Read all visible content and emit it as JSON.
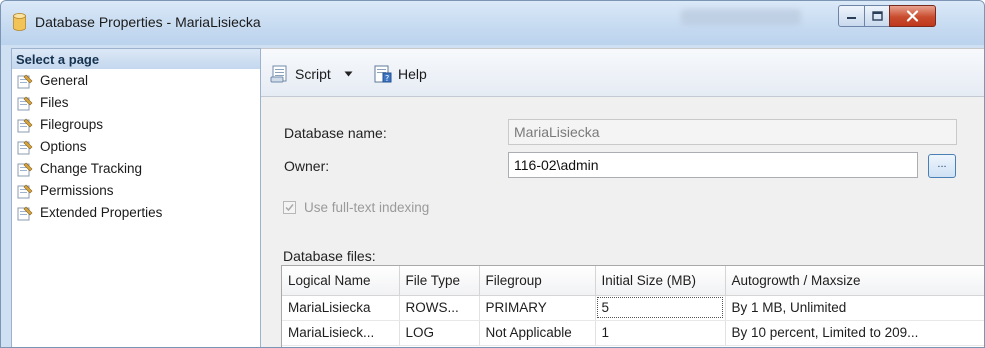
{
  "window": {
    "title": "Database Properties - MariaLisiecka",
    "icon": "database-icon",
    "controls": [
      "minimize-icon",
      "maximize-icon",
      "close-icon"
    ]
  },
  "sidebar": {
    "header": "Select a page",
    "items": [
      {
        "label": "General",
        "icon": "page-wrench-icon"
      },
      {
        "label": "Files",
        "icon": "page-wrench-icon"
      },
      {
        "label": "Filegroups",
        "icon": "page-wrench-icon"
      },
      {
        "label": "Options",
        "icon": "page-wrench-icon"
      },
      {
        "label": "Change Tracking",
        "icon": "page-wrench-icon"
      },
      {
        "label": "Permissions",
        "icon": "page-wrench-icon"
      },
      {
        "label": "Extended Properties",
        "icon": "page-wrench-icon"
      }
    ],
    "selected": "Files"
  },
  "toolbar": {
    "script_label": "Script",
    "help_label": "Help"
  },
  "form": {
    "database_name_label": "Database name:",
    "database_name_value": "MariaLisiecka",
    "owner_label": "Owner:",
    "owner_value": "116-02\\admin",
    "browse_label": "...",
    "fulltext_label": "Use full-text indexing",
    "fulltext_checked": true,
    "fulltext_enabled": false
  },
  "files": {
    "label": "Database files:",
    "columns": [
      "Logical Name",
      "File Type",
      "Filegroup",
      "Initial Size (MB)",
      "Autogrowth / Maxsize"
    ],
    "rows": [
      [
        "MariaLisiecka",
        "ROWS...",
        "PRIMARY",
        "5",
        "By 1 MB, Unlimited"
      ],
      [
        "MariaLisieck...",
        "LOG",
        "Not Applicable",
        "1",
        "By 10 percent, Limited to 209..."
      ]
    ]
  },
  "colors": {
    "titlebar": "#c7dbf1",
    "close_button": "#c94c2e",
    "panel_bg": "#f0f0f0"
  }
}
